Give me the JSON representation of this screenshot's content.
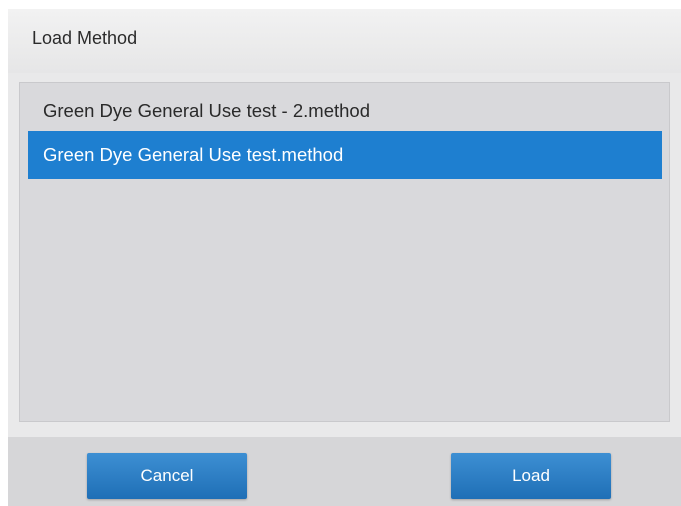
{
  "dialog": {
    "title": "Load Method",
    "items": [
      {
        "label": "Green Dye General Use test - 2.method",
        "selected": false
      },
      {
        "label": "Green Dye General Use test.method",
        "selected": true
      }
    ],
    "buttons": {
      "cancel_label": "Cancel",
      "load_label": "Load"
    },
    "colors": {
      "selection": "#1e7fd0",
      "button": "#2a7cc4"
    }
  }
}
